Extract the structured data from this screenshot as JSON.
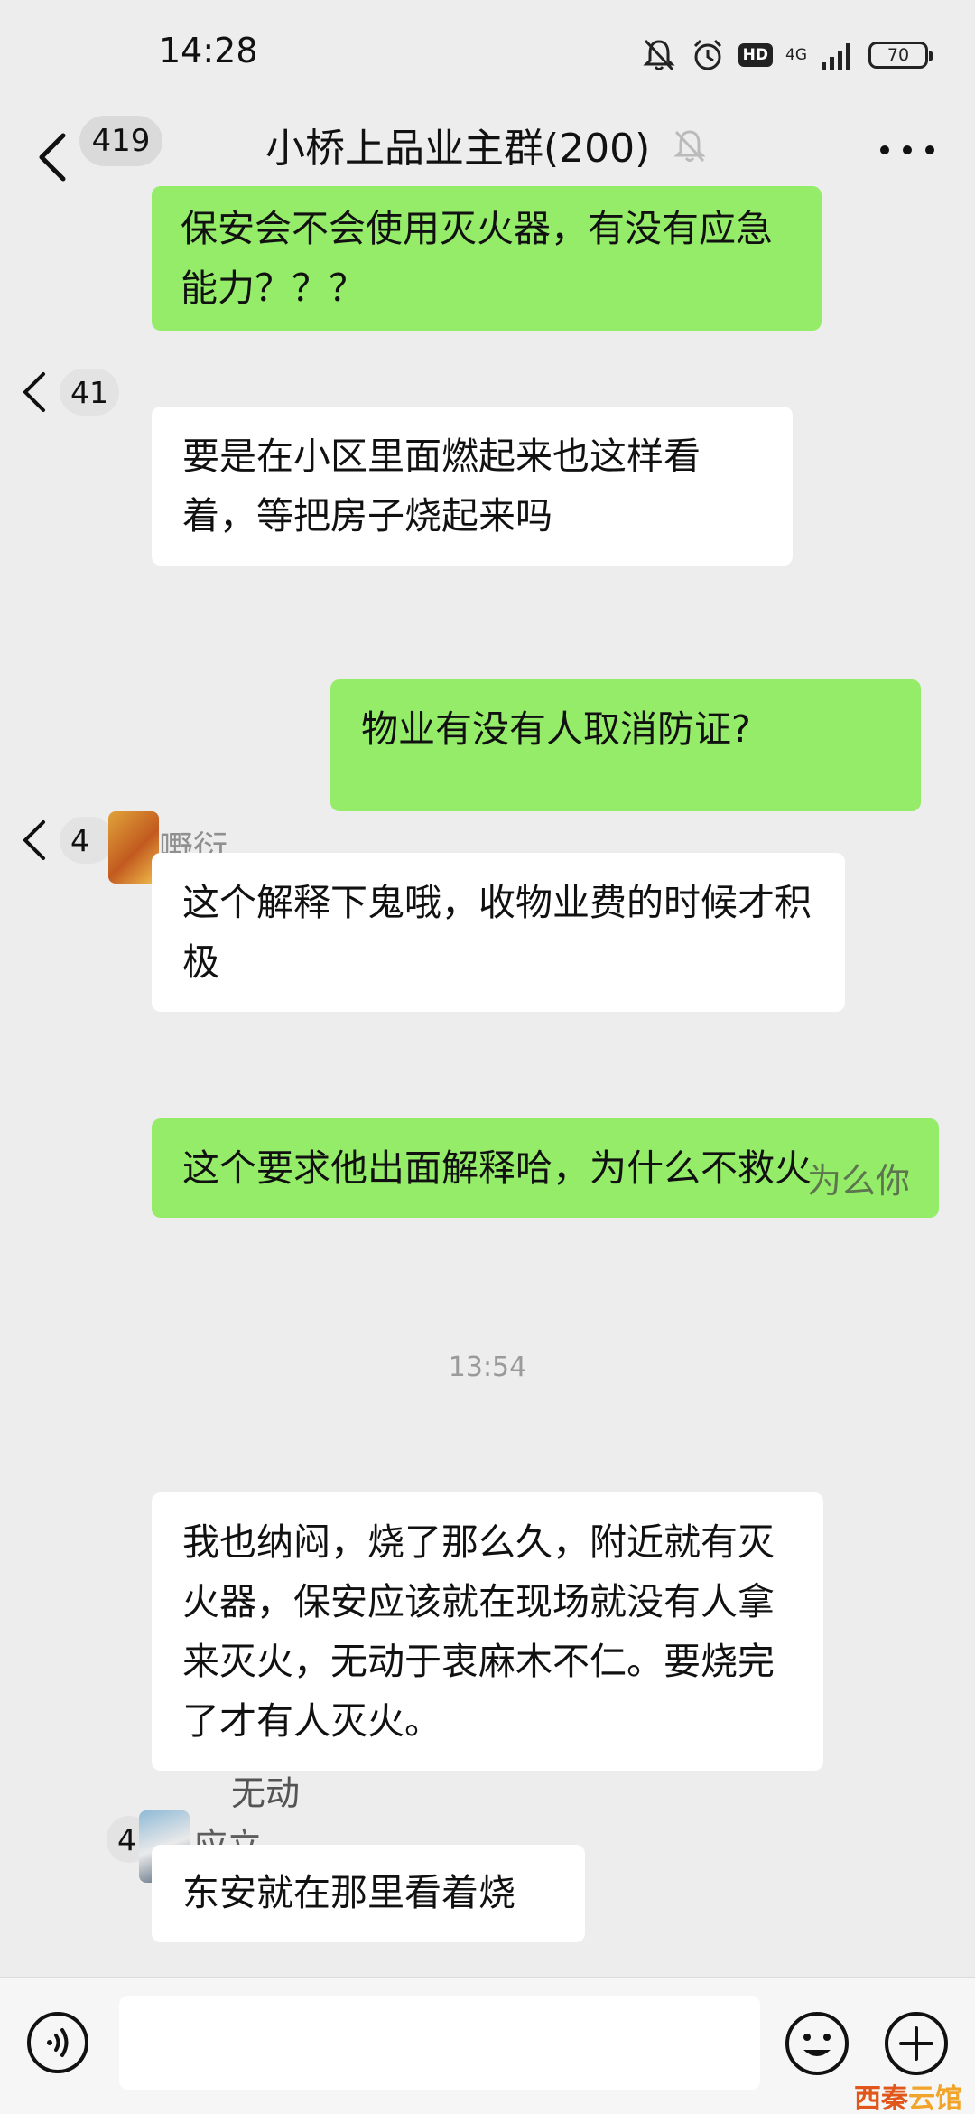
{
  "status_bar": {
    "time": "14:28",
    "hd": "HD",
    "network": "4G",
    "battery": "70"
  },
  "title_bar": {
    "unread_count": "419",
    "group_name": "小桥上品业主群(200)"
  },
  "messages": [
    {
      "side": "right",
      "text": "保安会不会使用灭火器，有没有应急能力？？？"
    },
    {
      "side": "left",
      "text": "要是在小区里面燃起来也这样看着，等把房子烧起来吗"
    },
    {
      "side": "right",
      "text": "物业有没有人取消防证?"
    },
    {
      "side": "left",
      "text": "这个解释下鬼哦，收物业费的时候才积极"
    },
    {
      "side": "right",
      "text": "这个要求他出面解释哈，为什么不救火"
    },
    {
      "side": "left",
      "text": "我也纳闷，烧了那么久，附近就有灭火器，保安应该就在现场就没有人拿来灭火，无动于衷麻木不仁。要烧完了才有人灭火。"
    },
    {
      "side": "left",
      "text": "东安就在那里看着烧"
    }
  ],
  "side_counts": [
    "41",
    "4",
    "4"
  ],
  "timestamp": "13:54",
  "ghost_texts": {
    "leak_1": "为么你",
    "leak_2": "无动",
    "leak_3": "应立",
    "leak_4": "嘢衍"
  },
  "input_bar": {
    "placeholder": ""
  },
  "watermark": {
    "part_a": "西秦",
    "part_b": "云馆"
  },
  "colors": {
    "green_bubble": "#95ec69",
    "white_bubble": "#ffffff",
    "background": "#ededed"
  }
}
